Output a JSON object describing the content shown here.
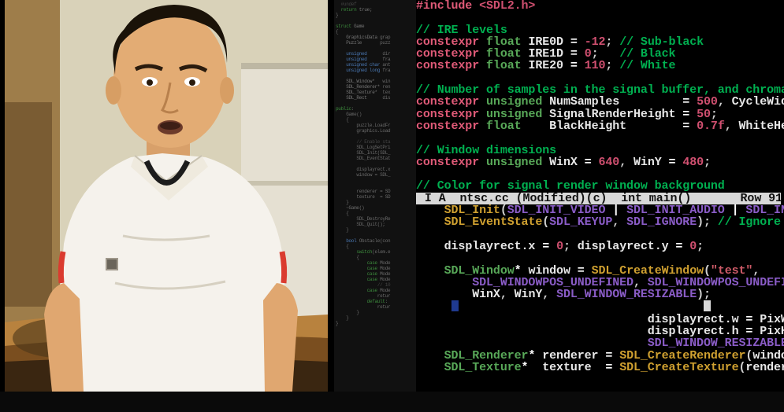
{
  "domain": "Computer-Use",
  "colors": {
    "background": "#000000",
    "comment": "#00b050",
    "keyword": "#e05a78",
    "type": "#58a858",
    "function": "#cfa030",
    "number": "#d05070",
    "macro": "#8a5cc7",
    "statusbar_bg": "#d8d8d8",
    "statusbar_fg": "#111111"
  },
  "webcam": {
    "description": "webcam-feed"
  },
  "statusbar": {
    "mode": "I A",
    "filename": "ntsc.cc",
    "modified": "(Modified)(c)",
    "context": "int main()",
    "row_label": "Row",
    "row": "91"
  },
  "minimap": {
    "gist": "struct Game { GraphicsData grap; Puzzle puzz; unsigned dir; unsigned fra; unsigned char ant; unsigned long fra; SDL_Window* win; SDL_Renderer* ren; SDL_Texture* tex; SDL_Rect disp; public: Game() { puzzle.LoadFr; graphics.Load; // Enable sta; SDL_LogSetPri; SDL_Init(SDL_; SDL_EventStat; displayrect.x; window = SDL_; renderer = SD; texture = SDL; } ~Game() { SDL_DestroyRe; SDL_Quit(); } bool Obstacle(con { switch(elem.e { case Mode; case Mode; case Mode; case Mode; // 10; case Mode; retur; default: retur; } } }"
  },
  "code": {
    "include_directive": "#include",
    "include_header": "<SDL2.h>",
    "comment_ire": "// IRE levels",
    "kw_constexpr": "constexpr",
    "kw_float": "float",
    "kw_unsigned": "unsigned",
    "ire0d_name": "IRE0D",
    "ire0d_val": "-12",
    "ire0d_cmt": "// Sub-black",
    "ire1d_name": "IRE1D",
    "ire1d_val": "0",
    "ire1d_cmt": "// Black",
    "ire20_name": "IRE20",
    "ire20_val": "110",
    "ire20_cmt": "// White",
    "comment_samples": "// Number of samples in the signal buffer, and chroma",
    "numsamples_name": "NumSamples",
    "numsamples_val": "500",
    "cyclewid_name": "CycleWid",
    "srh_name": "SignalRenderHeight",
    "srh_val": "50",
    "bh_name": "BlackHeight",
    "bh_val": "0.7f",
    "whitehe_name": "WhiteHe",
    "comment_windim": "// Window dimensions",
    "winx_name": "WinX",
    "winx_val": "640",
    "winy_name": "WinY",
    "winy_val": "480",
    "comment_sigcolor": "// Color for signal render window background",
    "sdl_init": "SDL_Init",
    "sdl_init_video": "SDL_INIT_VIDEO",
    "sdl_init_audio": "SDL_INIT_AUDIO",
    "sdl_in_tail": "SDL_IN",
    "sdl_eventstate": "SDL_EventState",
    "sdl_keyup": "SDL_KEYUP",
    "sdl_ignore": "SDL_IGNORE",
    "ignore_cmt": "// Ignore",
    "displayrect_x": "displayrect.x",
    "displayrect_y": "displayrect.y",
    "zero": "0",
    "sdl_window_type": "SDL_Window",
    "window_var": "window",
    "sdl_createwindow": "SDL_CreateWindow",
    "test_str": "\"test\"",
    "sdl_wpu": "SDL_WINDOWPOS_UNDEFINED",
    "sdl_wpu2": "SDL_WINDOWPOS_UNDEFI",
    "sdl_win_res": "SDL_WINDOW_RESIZABLE",
    "disp_w": "displayrect.w",
    "disp_h": "displayrect.h",
    "pixwidt": "PixWidt",
    "pixheig": "PixHeig",
    "sdl_renderer_type": "SDL_Renderer",
    "renderer_var": "renderer",
    "sdl_createrenderer": "SDL_CreateRenderer",
    "windo_tail": "windo",
    "sdl_texture_type": "SDL_Texture",
    "texture_var": "texture",
    "sdl_createtexture": "SDL_CreateTexture",
    "renderer_tail": "renderer"
  }
}
